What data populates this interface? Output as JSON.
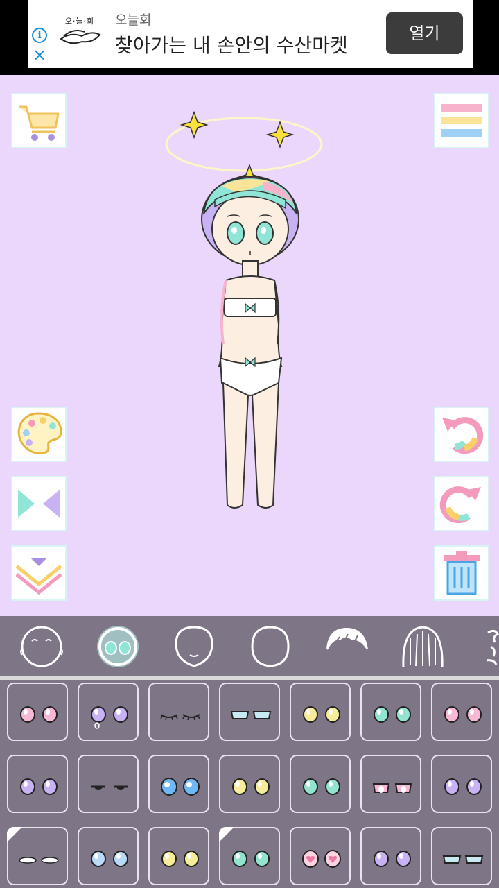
{
  "ad": {
    "logo_text": "오·늘·회",
    "brand": "오늘회",
    "headline": "찾아가는 내 손안의 수산마켓",
    "open_label": "열기",
    "info_icon": "info-icon",
    "close_icon": "close-icon"
  },
  "colors": {
    "stage_bg": "#ead7fb",
    "panel_bg": "#7e7587",
    "accent_mint": "#8fe6d6",
    "accent_pink": "#f7a8c8"
  },
  "tools": {
    "left": [
      "shopping-cart-icon",
      "palette-icon",
      "flip-icon",
      "collapse-icon"
    ],
    "right": [
      "menu-icon",
      "undo-icon",
      "redo-icon",
      "trash-icon"
    ]
  },
  "categories": [
    "face-base",
    "eyes",
    "face-shape",
    "head-shape",
    "bangs",
    "hair",
    "accessory"
  ],
  "selected_category": "eyes",
  "eye_items": [
    {
      "style": "round",
      "color": "#f6b8d4"
    },
    {
      "style": "round-tear",
      "color": "#c9b2f3"
    },
    {
      "style": "closed",
      "color": "#333333"
    },
    {
      "style": "half",
      "color": "#c8eaf2"
    },
    {
      "style": "round",
      "color": "#f6ec9a"
    },
    {
      "style": "round",
      "color": "#92e4d0"
    },
    {
      "style": "round",
      "color": "#f6b8d4"
    },
    {
      "style": "round",
      "color": "#c9b2f3"
    },
    {
      "style": "sleepy",
      "color": "#333333"
    },
    {
      "style": "big",
      "color": "#6fb8f3"
    },
    {
      "style": "round",
      "color": "#f6ec9a"
    },
    {
      "style": "round",
      "color": "#92e4d0"
    },
    {
      "style": "tongue",
      "color": "#f6b8d4"
    },
    {
      "style": "round",
      "color": "#c9b2f3"
    },
    {
      "style": "flat",
      "color": "#ffffff"
    },
    {
      "style": "round",
      "color": "#b9d9f6"
    },
    {
      "style": "round",
      "color": "#f6ec9a"
    },
    {
      "style": "round",
      "color": "#92e4d0"
    },
    {
      "style": "heart",
      "color": "#f07aa6"
    },
    {
      "style": "round",
      "color": "#c9b2f3"
    },
    {
      "style": "half",
      "color": "#c8eaf2"
    }
  ]
}
